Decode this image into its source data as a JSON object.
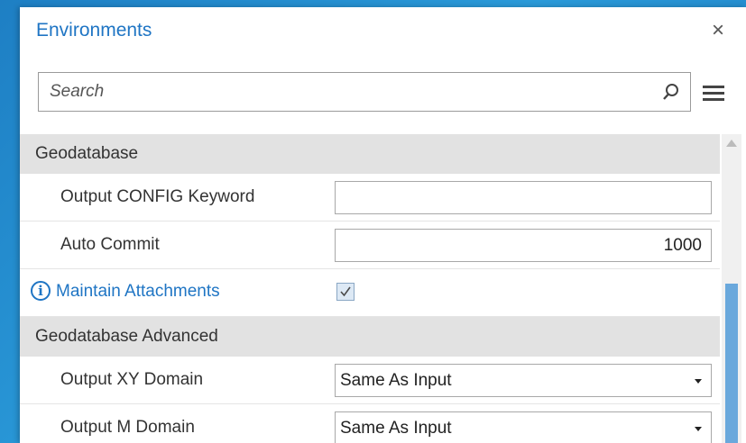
{
  "panel": {
    "title": "Environments",
    "close_glyph": "×"
  },
  "search": {
    "placeholder": "Search",
    "icon": "search-icon"
  },
  "menu": {
    "icon": "hamburger-menu-icon"
  },
  "sections": [
    {
      "name": "Geodatabase",
      "rows": [
        {
          "label": "Output CONFIG Keyword",
          "value": ""
        },
        {
          "label": "Auto Commit",
          "value": "1000"
        },
        {
          "label": "Maintain Attachments",
          "checked": true,
          "info_icon": "info-icon"
        }
      ]
    },
    {
      "name": "Geodatabase Advanced",
      "rows": [
        {
          "label": "Output XY Domain",
          "value": "Same As Input"
        },
        {
          "label": "Output M Domain",
          "value": "Same As Input"
        }
      ]
    }
  ],
  "colors": {
    "accent": "#1f75c4",
    "section_bg": "#e2e2e2",
    "scroll_thumb": "#6aa8dc"
  }
}
